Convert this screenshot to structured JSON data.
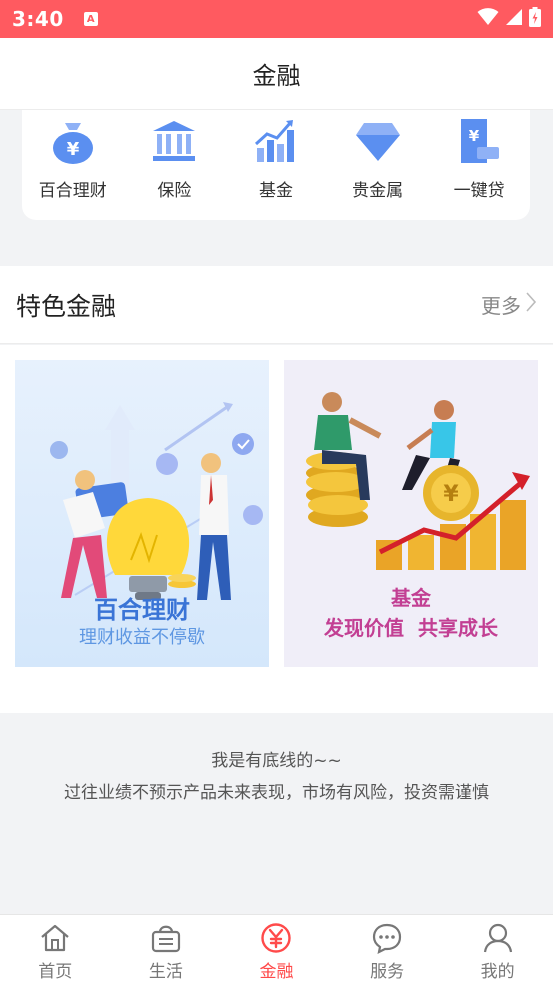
{
  "status_bar": {
    "time": "3:40",
    "notification_badge": "A"
  },
  "header": {
    "title": "金融"
  },
  "categories": [
    {
      "label": "百合理财",
      "icon": "money-bag-icon"
    },
    {
      "label": "保险",
      "icon": "bank-icon"
    },
    {
      "label": "基金",
      "icon": "growth-chart-icon"
    },
    {
      "label": "贵金属",
      "icon": "diamond-icon"
    },
    {
      "label": "一键贷",
      "icon": "loan-receipt-icon"
    }
  ],
  "featured": {
    "title": "特色金融",
    "more": "更多",
    "cards": [
      {
        "title": "百合理财",
        "subtitle": "理财收益不停歇"
      },
      {
        "title": "基金",
        "subtitle": "发现价值  共享成长"
      }
    ]
  },
  "footer": {
    "line1": "我是有底线的~~",
    "line2": "过往业绩不预示产品未来表现，市场有风险，投资需谨慎"
  },
  "bottom_nav": [
    {
      "label": "首页",
      "icon": "home-icon",
      "active": false
    },
    {
      "label": "生活",
      "icon": "basket-icon",
      "active": false
    },
    {
      "label": "金融",
      "icon": "yuan-icon",
      "active": true
    },
    {
      "label": "服务",
      "icon": "chat-icon",
      "active": false
    },
    {
      "label": "我的",
      "icon": "user-icon",
      "active": false
    }
  ],
  "colors": {
    "status_bar": "#ff5a60",
    "accent": "#ff4a4a",
    "icon_blue": "#5b8ff0"
  }
}
